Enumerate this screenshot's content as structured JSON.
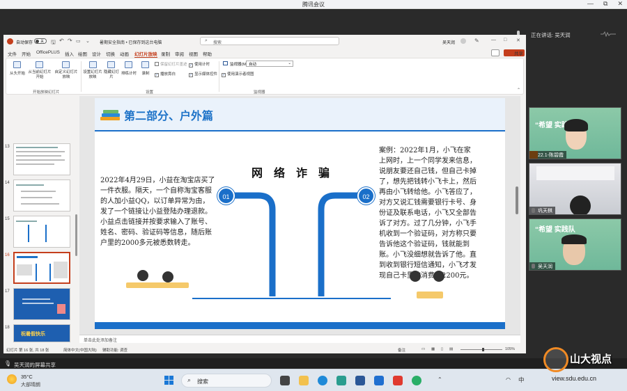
{
  "window": {
    "title": "腾讯会议",
    "minimize": "—",
    "maximize": "□",
    "restore": "⧉",
    "close": "✕"
  },
  "meeting": {
    "speaking_label": "正在讲话:",
    "speaking_name": "吴天润",
    "share_label": "吴天润的屏幕共享",
    "participants": [
      {
        "name": "22.1-陈碧霞",
        "banner": "“希望 实践队"
      },
      {
        "name": "巩天棋"
      },
      {
        "name": "吴天润",
        "banner": "“希望 实践队"
      }
    ]
  },
  "ppt": {
    "autosave_label": "自动保存",
    "autosave_state": "关",
    "doc_title": "暑期安全指南 • 已保存到这台电脑",
    "search_placeholder": "搜索",
    "user_name": "吴天润",
    "share_button": "共享",
    "tabs": [
      "文件",
      "开始",
      "OfficePLUS",
      "插入",
      "绘图",
      "设计",
      "切换",
      "动画",
      "幻灯片放映",
      "录制",
      "审阅",
      "视图",
      "帮助"
    ],
    "active_tab": "幻灯片放映",
    "ribbon": {
      "buttons": [
        "从头开始",
        "从当前幻灯片开始",
        "自定义幻灯片放映",
        "设置幻灯片放映",
        "隐藏幻灯片",
        "排练计时",
        "录制"
      ],
      "checkboxes": [
        "播放旁白",
        "使用计时",
        "显示媒体控件",
        "使用演示者视图"
      ],
      "muted_item": "保留幻灯片墨迹",
      "monitor_label": "监视器(M):",
      "monitor_value": "自动",
      "groups": [
        "开始放映幻灯片",
        "设置",
        "监视器"
      ]
    },
    "thumbnails": [
      {
        "num": "13"
      },
      {
        "num": "14"
      },
      {
        "num": "15"
      },
      {
        "num": "16"
      },
      {
        "num": "17"
      },
      {
        "num": "18",
        "text": "祝暑假快乐"
      }
    ],
    "notes_placeholder": "单击此处添加备注",
    "status": {
      "slide_pos": "幻灯片 第 16 张, 共 18 张",
      "language": "简体中文(中国大陆)",
      "accessibility": "辅助功能: 调查",
      "notes": "备注",
      "zoom": "105%"
    }
  },
  "slide": {
    "section_title": "第二部分、户外篇",
    "heading": "网络诈骗",
    "circle_1": "01",
    "circle_2": "02",
    "left_text": "2022年4月29日，小益在淘宝店买了一件衣服。隔天，一个自称淘宝客服的人加小益QQ，以订单异常为由，发了一个链接让小益登陆办理退款。小益点击链接并按要求输入了账号、姓名、密码、验证码等信息，随后账户里的2000多元被悉数转走。",
    "right_text": "案例：2022年1月，小飞在家上网时，上一个同学发来信息，说朋友要还自己钱，但自己卡掉了，想先把钱转小飞卡上，然后再由小飞转给他。小飞答应了，对方又说汇钱需要银行卡号、身份证及联系电话，小飞又全部告诉了对方。过了几分钟，小飞手机收到一个验证码，对方称只要告诉他这个验证码，钱就能到账。小飞没细想就告诉了他。直到收到银行短信通知，小飞才发现自己卡里被消费了2200元。"
  },
  "taskbar": {
    "weather_temp": "35°C",
    "weather_desc": "大部晴朗",
    "search_label": "搜索",
    "ime": "中",
    "watermark": "山大视点",
    "watermark_url": "view.sdu.edu.cn"
  },
  "colors": {
    "accent": "#1a6fc9",
    "ppt_red": "#c43e1c",
    "slide_title": "#1e73c8"
  }
}
